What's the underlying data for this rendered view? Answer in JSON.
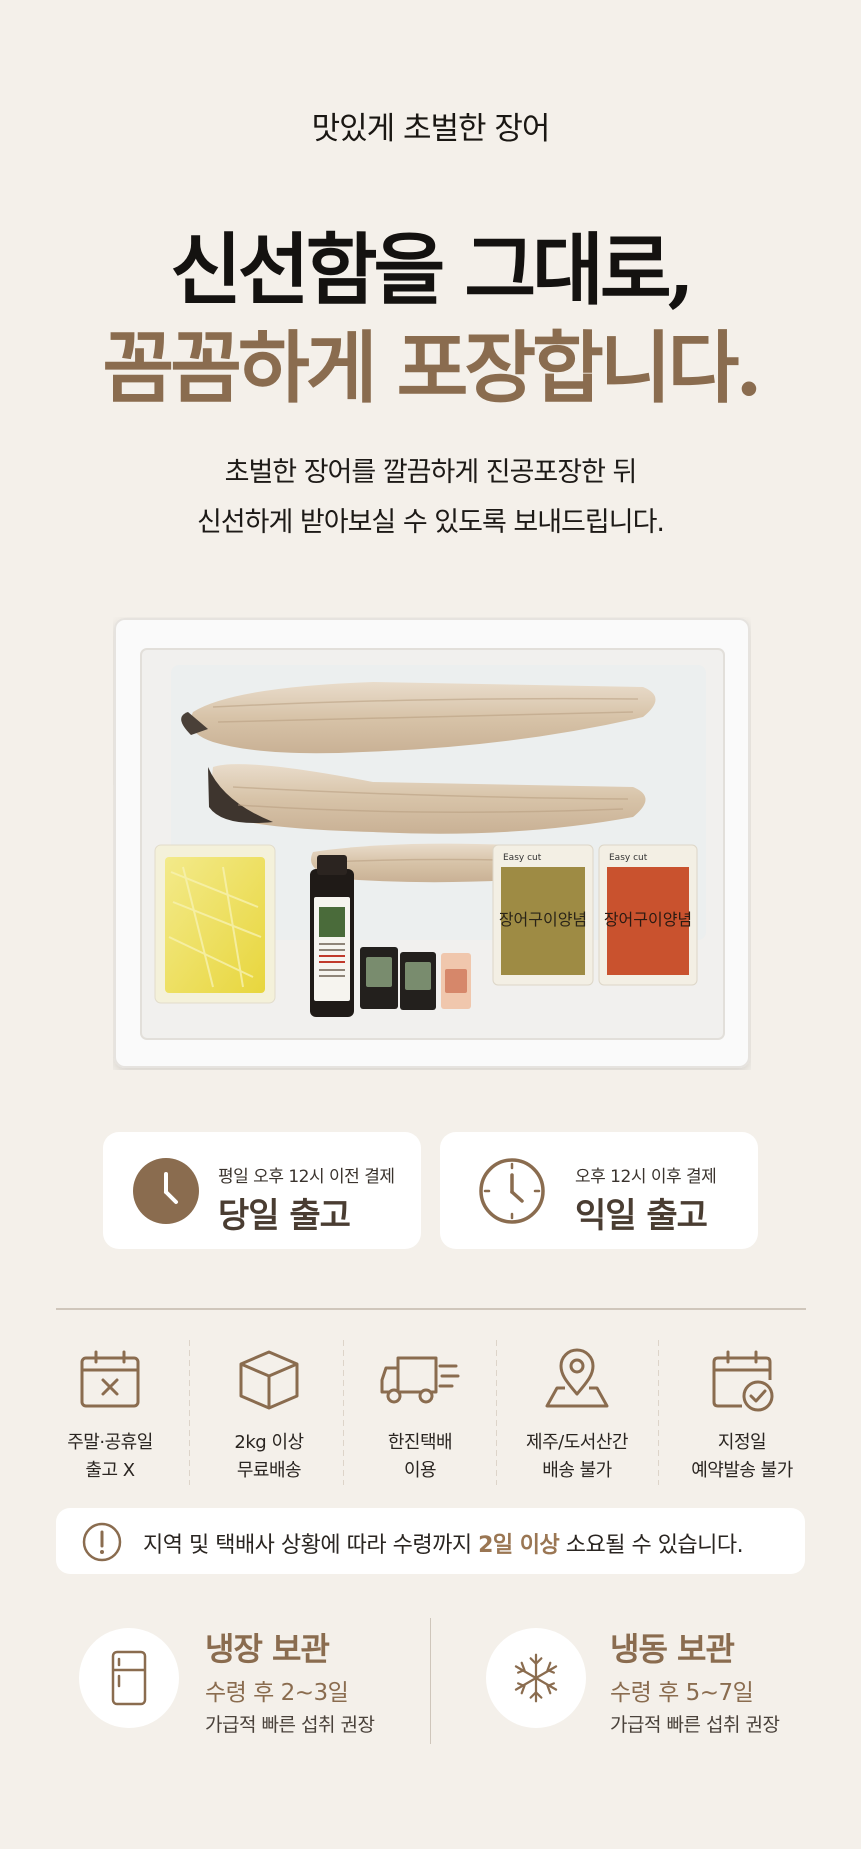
{
  "intro": "맛있게 초벌한 장어",
  "headline": {
    "line1": "신선함을 그대로,",
    "line2": "꼼꼼하게 포장합니다."
  },
  "description": {
    "line1": "초벌한 장어를 깔끔하게 진공포장한 뒤",
    "line2": "신선하게 받아보실 수 있도록 보내드립니다."
  },
  "photo": {
    "sauce_packet_1": "장어구이양념",
    "sauce_packet_2": "장어구이양념",
    "easy_cut": "Easy cut"
  },
  "shipping": [
    {
      "condition": "평일 오후 12시 이전 결제",
      "result": "당일 출고",
      "icon": "clock-filled-icon"
    },
    {
      "condition": "오후 12시 이후 결제",
      "result": "익일 출고",
      "icon": "clock-outline-icon"
    }
  ],
  "features": [
    {
      "line1": "주말·공휴일",
      "line2": "출고 X",
      "icon": "calendar-x-icon"
    },
    {
      "line1": "2kg 이상",
      "line2": "무료배송",
      "icon": "box-icon"
    },
    {
      "line1": "한진택배",
      "line2": "이용",
      "icon": "truck-icon"
    },
    {
      "line1": "제주/도서산간",
      "line2": "배송 불가",
      "icon": "map-pin-icon"
    },
    {
      "line1": "지정일",
      "line2": "예약발송 불가",
      "icon": "calendar-check-icon"
    }
  ],
  "notice": {
    "before": "지역 및 택배사 상황에 따라 수령까지 ",
    "highlight": "2일 이상",
    "after": " 소요될 수 있습니다.",
    "icon": "exclamation-icon"
  },
  "storage": [
    {
      "title": "냉장 보관",
      "range": "수령 후 2~3일",
      "note": "가급적 빠른 섭취 권장",
      "icon": "refrigerator-icon"
    },
    {
      "title": "냉동 보관",
      "range": "수령 후 5~7일",
      "note": "가급적 빠른 섭취 권장",
      "icon": "snowflake-icon"
    }
  ],
  "colors": {
    "background": "#f4f0ea",
    "accent_brown": "#8a6c4f",
    "dark_brown": "#4a3d32",
    "card": "#ffffff"
  }
}
